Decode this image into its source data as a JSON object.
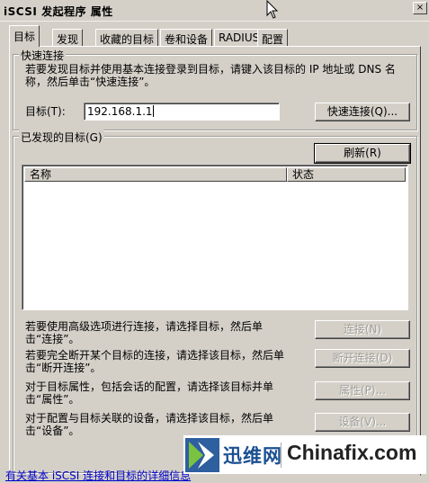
{
  "window": {
    "title": "iSCSI 发起程序 属性",
    "close_label": "×"
  },
  "tabs": [
    {
      "label": "目标"
    },
    {
      "label": "发现"
    },
    {
      "label": "收藏的目标"
    },
    {
      "label": "卷和设备"
    },
    {
      "label": "RADIUS"
    },
    {
      "label": "配置"
    }
  ],
  "quick_connect": {
    "legend": "快速连接",
    "description": "若要发现目标并使用基本连接登录到目标，请键入该目标的 IP 地址或 DNS 名称，然后单击“快速连接”。",
    "target_label": "目标(T):",
    "target_value": "192.168.1.1",
    "button_label": "快速连接(Q)..."
  },
  "discovered": {
    "legend": "已发现的目标(G)",
    "refresh_label": "刷新(R)",
    "columns": [
      "名称",
      "状态"
    ],
    "rows": []
  },
  "actions": [
    {
      "text": "若要使用高级选项进行连接，请选择目标，然后单击“连接”。",
      "button": "连接(N)"
    },
    {
      "text": "若要完全断开某个目标的连接，请选择该目标，然后单击“断开连接”。",
      "button": "断开连接(D)"
    },
    {
      "text": "对于目标属性，包括会话的配置，请选择该目标并单击“属性”。",
      "button": "属性(P)..."
    },
    {
      "text": "对于配置与目标关联的设备，请选择该目标，然后单击“设备”。",
      "button": "设备(V)..."
    }
  ],
  "bottom_link": "有关基本 iSCSI 连接和目标的详细信息",
  "watermark": {
    "cn": "迅维网",
    "en": "Chinafix.com"
  }
}
